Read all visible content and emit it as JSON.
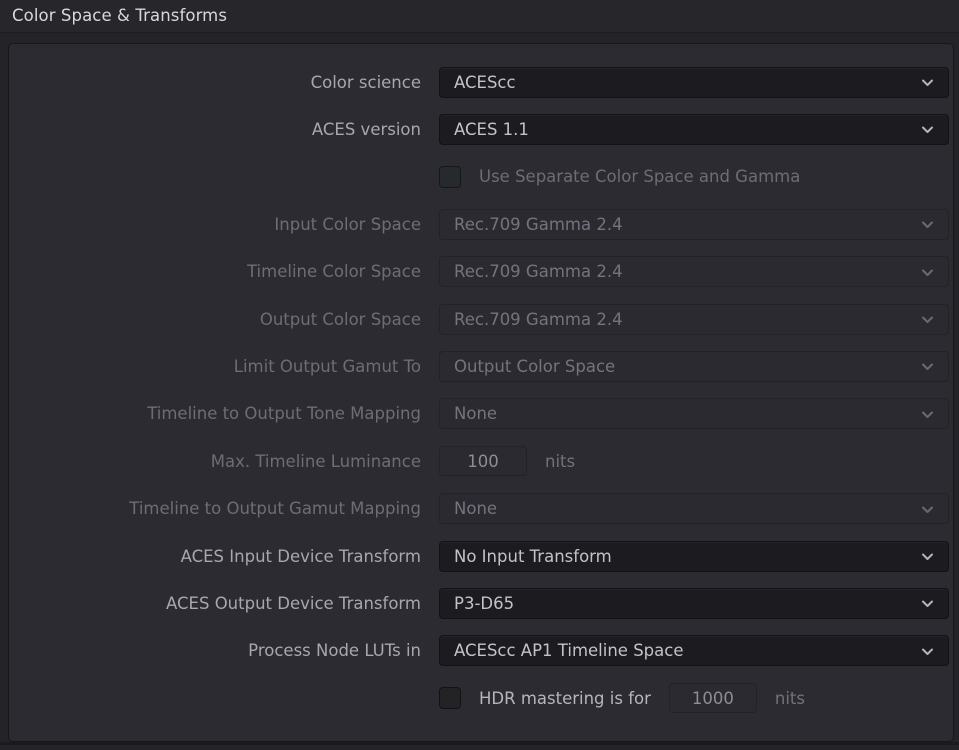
{
  "window": {
    "title": "Color Space & Transforms"
  },
  "colors": {
    "panel_bg": "#2b2b31",
    "window_bg": "#232328",
    "titlebar_bg": "#26262b",
    "title_text": "#d8d8dc",
    "label_enabled": "#a7a7ad",
    "label_disabled": "#6d6d77",
    "select_enabled_bg": "#1c1c20",
    "select_disabled_bg": "#2a2a30",
    "value_enabled": "#c2c2c8",
    "value_disabled": "#747480"
  },
  "rows": [
    {
      "id": "color-science",
      "label": "Color science",
      "label_state": "enabled",
      "control": "select",
      "value": "ACEScc",
      "state": "enabled",
      "icon": "chevron-down-icon"
    },
    {
      "id": "aces-version",
      "label": "ACES version",
      "label_state": "enabled",
      "control": "select",
      "value": "ACES 1.1",
      "state": "enabled",
      "icon": "chevron-down-icon"
    },
    {
      "id": "use-separate-color-space-and-gamma",
      "label": "",
      "label_state": "enabled",
      "control": "checkbox",
      "value": "Use Separate Color Space and Gamma",
      "checked": false,
      "state": "disabled",
      "icon": "checkbox-unchecked-icon"
    },
    {
      "id": "input-color-space",
      "label": "Input Color Space",
      "label_state": "disabled",
      "control": "select",
      "value": "Rec.709 Gamma 2.4",
      "state": "disabled",
      "icon": "chevron-down-icon"
    },
    {
      "id": "timeline-color-space",
      "label": "Timeline Color Space",
      "label_state": "disabled",
      "control": "select",
      "value": "Rec.709 Gamma 2.4",
      "state": "disabled",
      "icon": "chevron-down-icon"
    },
    {
      "id": "output-color-space",
      "label": "Output Color Space",
      "label_state": "disabled",
      "control": "select",
      "value": "Rec.709 Gamma 2.4",
      "state": "disabled",
      "icon": "chevron-down-icon"
    },
    {
      "id": "limit-output-gamut-to",
      "label": "Limit Output Gamut To",
      "label_state": "disabled",
      "control": "select",
      "value": "Output Color Space",
      "state": "disabled",
      "icon": "chevron-down-icon"
    },
    {
      "id": "timeline-to-output-tone-mapping",
      "label": "Timeline to Output Tone Mapping",
      "label_state": "disabled",
      "control": "select",
      "value": "None",
      "state": "disabled",
      "icon": "chevron-down-icon"
    },
    {
      "id": "max-timeline-luminance",
      "label": "Max. Timeline Luminance",
      "label_state": "disabled",
      "control": "number",
      "value": "100",
      "unit": "nits",
      "state": "disabled"
    },
    {
      "id": "timeline-to-output-gamut-mapping",
      "label": "Timeline to Output Gamut Mapping",
      "label_state": "disabled",
      "control": "select",
      "value": "None",
      "state": "disabled",
      "icon": "chevron-down-icon"
    },
    {
      "id": "aces-input-device-transform",
      "label": "ACES Input Device Transform",
      "label_state": "enabled",
      "control": "select",
      "value": "No Input Transform",
      "state": "enabled",
      "icon": "chevron-down-icon"
    },
    {
      "id": "aces-output-device-transform",
      "label": "ACES Output Device Transform",
      "label_state": "enabled",
      "control": "select",
      "value": "P3-D65",
      "state": "enabled",
      "icon": "chevron-down-icon"
    },
    {
      "id": "process-node-luts-in",
      "label": "Process Node LUTs in",
      "label_state": "enabled",
      "control": "select",
      "value": "ACEScc AP1 Timeline Space",
      "state": "enabled",
      "icon": "chevron-down-icon"
    },
    {
      "id": "hdr-mastering-is-for",
      "label": "",
      "label_state": "enabled",
      "control": "checkbox-number",
      "value": "HDR mastering is for",
      "checked": false,
      "number": "1000",
      "unit": "nits",
      "state": "enabled",
      "icon": "checkbox-unchecked-icon"
    }
  ]
}
